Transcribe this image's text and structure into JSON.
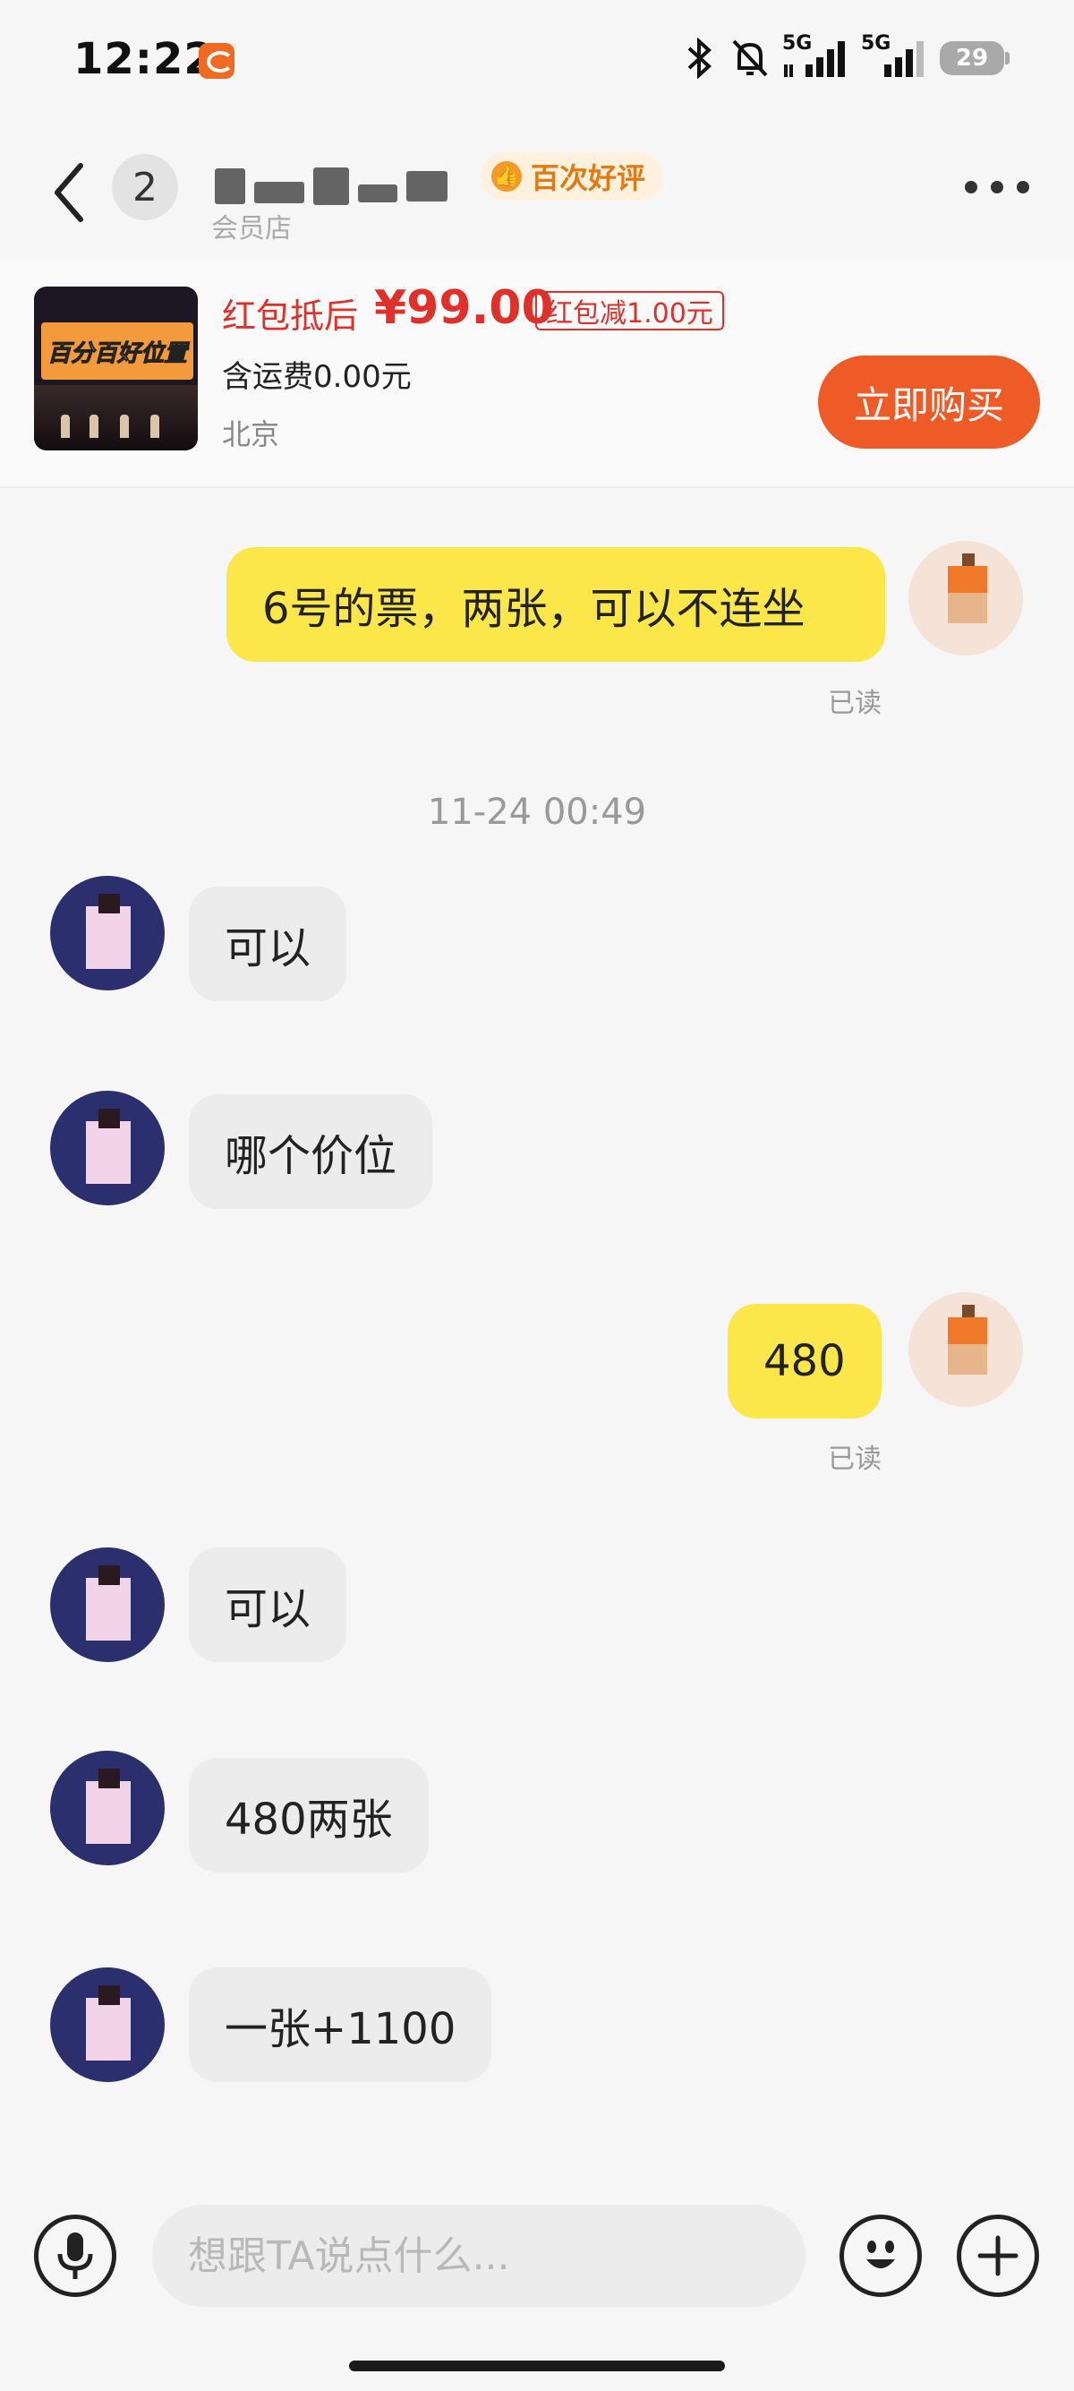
{
  "status_bar": {
    "time": "12:22",
    "app_icon": "1688-app-icon",
    "network_1": "5G",
    "network_2": "5G",
    "battery": "29"
  },
  "header": {
    "unread_count": "2",
    "shop_sub": "会员店",
    "rating_badge": "百次好评",
    "icons": [
      "chevron-left-icon",
      "more-dots-icon"
    ]
  },
  "product": {
    "thumb_caption": "百分百好位置",
    "price_label": "红包抵后",
    "price": "¥99.00",
    "discount_tag": "红包减1.00元",
    "shipping": "含运费0.00元",
    "location": "北京",
    "buy_button": "立即购买"
  },
  "chat": {
    "timestamp": "11-24 00:49",
    "read_label": "已读",
    "messages": [
      {
        "side": "me",
        "text": "6号的票，两张，可以不连坐"
      },
      {
        "side": "them",
        "text": "可以"
      },
      {
        "side": "them",
        "text": "哪个价位"
      },
      {
        "side": "me",
        "text": "480"
      },
      {
        "side": "them",
        "text": "可以"
      },
      {
        "side": "them",
        "text": "480两张"
      },
      {
        "side": "them",
        "text": "一张+1100"
      }
    ]
  },
  "input": {
    "placeholder": "想跟TA说点什么...",
    "icons": [
      "microphone-icon",
      "emoji-icon",
      "plus-icon"
    ]
  },
  "colors": {
    "accent_orange": "#ef5b26",
    "price_red": "#e0302a",
    "my_bubble": "#fce74a",
    "their_bubble": "#ececec"
  }
}
